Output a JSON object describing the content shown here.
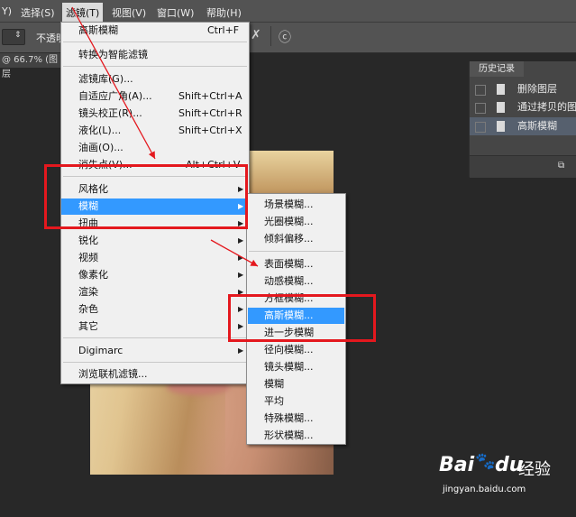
{
  "menubar": {
    "items": [
      "Y)",
      "选择(S)",
      "滤镜(T)",
      "视图(V)",
      "窗口(W)",
      "帮助(H)"
    ],
    "active_index": 2
  },
  "options_bar": {
    "opacity_label": "不透明"
  },
  "doc_tab": {
    "label": "@ 66.7% (图层"
  },
  "filter_menu": {
    "items": [
      {
        "label": "高斯模糊",
        "shortcut": "Ctrl+F"
      },
      {
        "label": "转换为智能滤镜"
      },
      {
        "label": "滤镜库(G)..."
      },
      {
        "label": "自适应广角(A)...",
        "shortcut": "Shift+Ctrl+A"
      },
      {
        "label": "镜头校正(R)...",
        "shortcut": "Shift+Ctrl+R"
      },
      {
        "label": "液化(L)...",
        "shortcut": "Shift+Ctrl+X"
      },
      {
        "label": "油画(O)..."
      },
      {
        "label": "消失点(V)...",
        "shortcut": "Alt+Ctrl+V"
      },
      {
        "label": "风格化"
      },
      {
        "label": "模糊"
      },
      {
        "label": "扭曲"
      },
      {
        "label": "锐化"
      },
      {
        "label": "视频"
      },
      {
        "label": "像素化"
      },
      {
        "label": "渲染"
      },
      {
        "label": "杂色"
      },
      {
        "label": "其它"
      },
      {
        "label": "Digimarc"
      },
      {
        "label": "浏览联机滤镜..."
      }
    ]
  },
  "blur_submenu": {
    "items": [
      {
        "label": "场景模糊..."
      },
      {
        "label": "光圈模糊..."
      },
      {
        "label": "倾斜偏移..."
      },
      {
        "label": "表面模糊..."
      },
      {
        "label": "动感模糊..."
      },
      {
        "label": "方框模糊..."
      },
      {
        "label": "高斯模糊..."
      },
      {
        "label": "进一步模糊"
      },
      {
        "label": "径向模糊..."
      },
      {
        "label": "镜头模糊..."
      },
      {
        "label": "模糊"
      },
      {
        "label": "平均"
      },
      {
        "label": "特殊模糊..."
      },
      {
        "label": "形状模糊..."
      }
    ],
    "highlighted_index": 6
  },
  "history_panel": {
    "title": "历史记录",
    "rows": [
      {
        "label": "删除图层"
      },
      {
        "label": "通过拷贝的图"
      },
      {
        "label": "高斯模糊"
      }
    ],
    "selected_index": 2
  },
  "watermark": {
    "brand": "Bai",
    "brand2": "du",
    "suffix": "经验",
    "url": "jingyan.baidu.com"
  },
  "colors": {
    "highlight": "#3399ff",
    "annotation_red": "#e4181e",
    "menu_bg": "#f0f0f0",
    "app_bg": "#282828"
  }
}
